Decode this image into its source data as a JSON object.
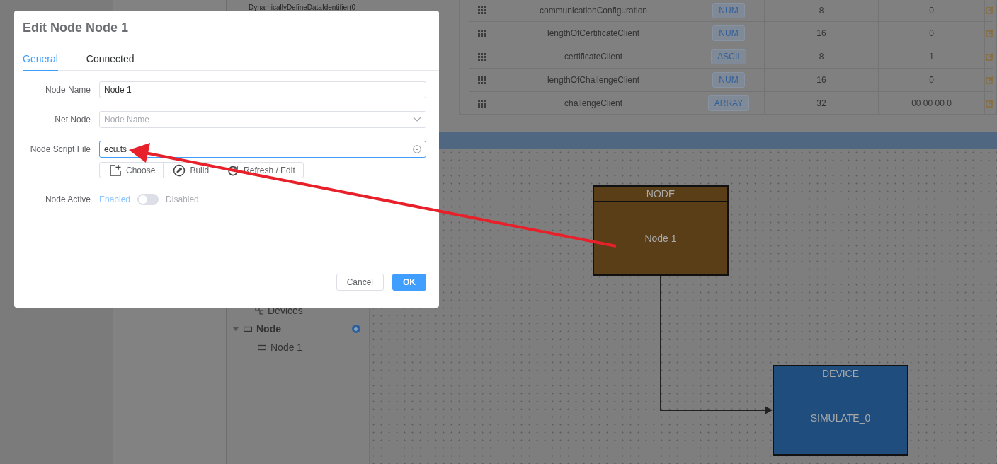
{
  "background_list": {
    "items": [
      "DynamicallyDefineDataIdentifier(0"
    ]
  },
  "table": {
    "rows": [
      {
        "name": "communicationConfiguration",
        "type": "NUM",
        "length": "8",
        "value": "0"
      },
      {
        "name": "lengthOfCertificateClient",
        "type": "NUM",
        "length": "16",
        "value": "0"
      },
      {
        "name": "certificateClient",
        "type": "ASCII",
        "length": "8",
        "value": "1"
      },
      {
        "name": "lengthOfChallengeClient",
        "type": "NUM",
        "length": "16",
        "value": "0"
      },
      {
        "name": "challengeClient",
        "type": "ARRAY",
        "length": "32",
        "value": "00 00 00 0"
      }
    ]
  },
  "tree": {
    "items": [
      {
        "label": "Devices",
        "kind": "devices"
      },
      {
        "label": "Node",
        "kind": "group",
        "expanded": true,
        "children": [
          {
            "label": "Node 1",
            "kind": "node"
          }
        ]
      }
    ]
  },
  "diagram": {
    "nodes": [
      {
        "header": "NODE",
        "label": "Node 1",
        "color": "#5a3e17"
      },
      {
        "header": "DEVICE",
        "label": "SIMULATE_0",
        "color": "#1f4d7e"
      }
    ]
  },
  "dialog": {
    "title": "Edit Node Node 1",
    "tabs": [
      {
        "label": "General",
        "selected": true
      },
      {
        "label": "Connected",
        "selected": false
      }
    ],
    "fields": [
      {
        "kind": "input",
        "label": "Node Name",
        "value": "Node 1",
        "focused": false
      },
      {
        "kind": "select",
        "label": "Net Node",
        "placeholder": "Node Name"
      },
      {
        "kind": "file",
        "label": "Node Script File",
        "value": "ecu.ts",
        "focused": true,
        "actions": [
          "Choose",
          "Build",
          "Refresh / Edit"
        ]
      },
      {
        "kind": "switch",
        "label": "Node Active",
        "on_text": "Enabled",
        "off_text": "Disabled",
        "on": false
      }
    ],
    "buttons": [
      {
        "label": "Cancel",
        "kind": "default"
      },
      {
        "label": "OK",
        "kind": "primary"
      }
    ]
  }
}
